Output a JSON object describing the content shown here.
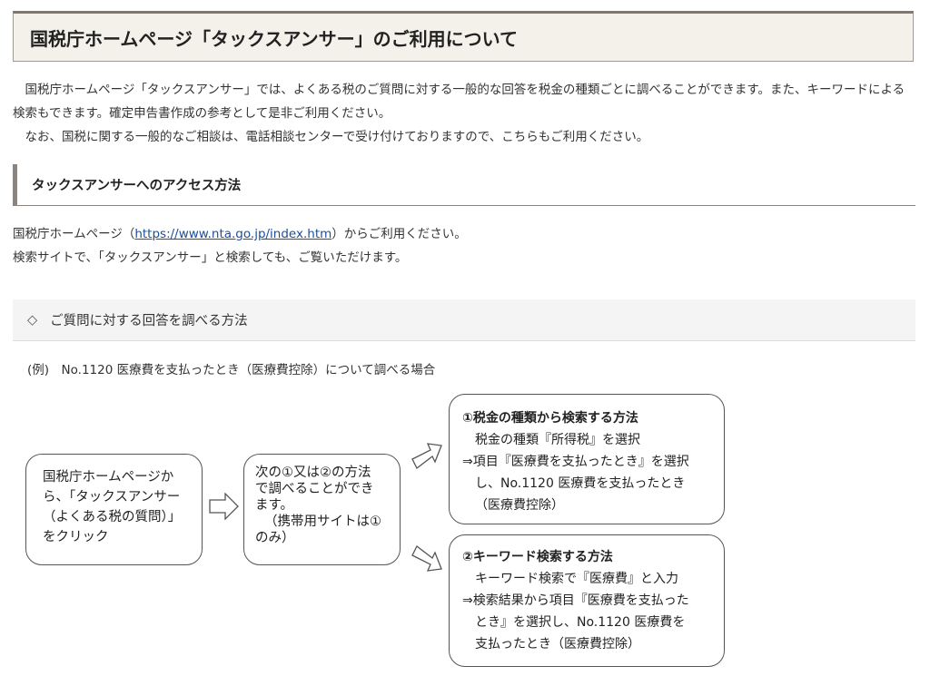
{
  "main": {
    "title": "国税庁ホームページ「タックスアンサー」のご利用について",
    "intro": [
      "　国税庁ホームページ「タックスアンサー」では、よくある税のご質問に対する一般的な回答を税金の種類ごとに調べることができます。また、キーワードによる検索もできます。確定申告書作成の参考として是非ご利用ください。",
      "　なお、国税に関する一般的なご相談は、電話相談センターで受け付けておりますので、こちらもご利用ください。"
    ]
  },
  "access": {
    "heading": "タックスアンサーへのアクセス方法",
    "line1_prefix": "国税庁ホームページ（",
    "link": "https://www.nta.go.jp/index.htm",
    "line1_suffix": "）からご利用ください。",
    "line2": "検索サイトで、「タックスアンサー」と検索しても、ご覧いただけます。"
  },
  "method": {
    "bar_icon": "◇",
    "bar_label": "ご質問に対する回答を調べる方法",
    "example": "(例)　No.1120 医療費を支払ったとき（医療費控除）について調べる場合"
  },
  "flow": {
    "step1": [
      "国税庁ホームページか",
      "ら、「タックスアンサー",
      "（よくある税の質問）」",
      "をクリック"
    ],
    "step2": [
      "次の①又は②の方法",
      "で調べることができ",
      "ます。",
      "（携帯用サイトは①",
      "のみ）"
    ],
    "option1": {
      "title": "①税金の種類から検索する方法",
      "lines": [
        "税金の種類『所得税』を選択",
        "⇒項目『医療費を支払ったとき』を選択",
        "し、No.1120 医療費を支払ったとき",
        "（医療費控除）"
      ]
    },
    "option2": {
      "title": "②キーワード検索する方法",
      "lines": [
        "キーワード検索で『医療費』と入力",
        "⇒検索結果から項目『医療費を支払った",
        "とき』を選択し、No.1120 医療費を",
        "支払ったとき（医療費控除）"
      ]
    }
  }
}
